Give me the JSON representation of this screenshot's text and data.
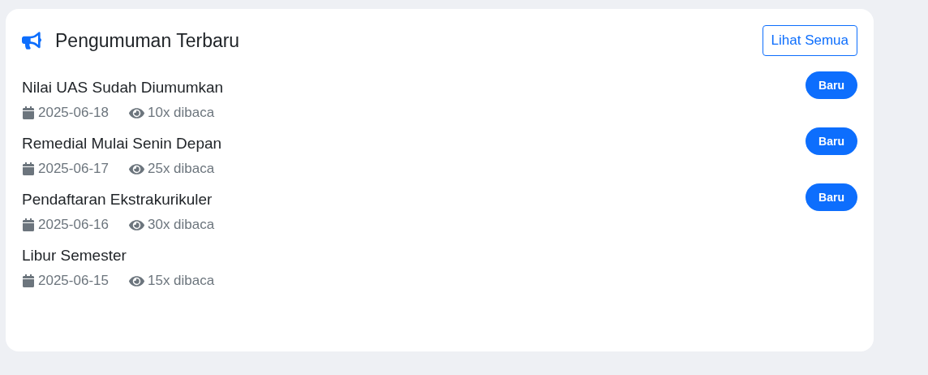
{
  "card": {
    "title": "Pengumuman Terbaru",
    "action": "Lihat Semua"
  },
  "announcements": [
    {
      "title": "Nilai UAS Sudah Diumumkan",
      "date": "2025-06-18",
      "views": "10x dibaca",
      "badge": "Baru"
    },
    {
      "title": "Remedial Mulai Senin Depan",
      "date": "2025-06-17",
      "views": "25x dibaca",
      "badge": "Baru"
    },
    {
      "title": "Pendaftaran Ekstrakurikuler",
      "date": "2025-06-16",
      "views": "30x dibaca",
      "badge": "Baru"
    },
    {
      "title": "Libur Semester",
      "date": "2025-06-15",
      "views": "15x dibaca"
    }
  ]
}
